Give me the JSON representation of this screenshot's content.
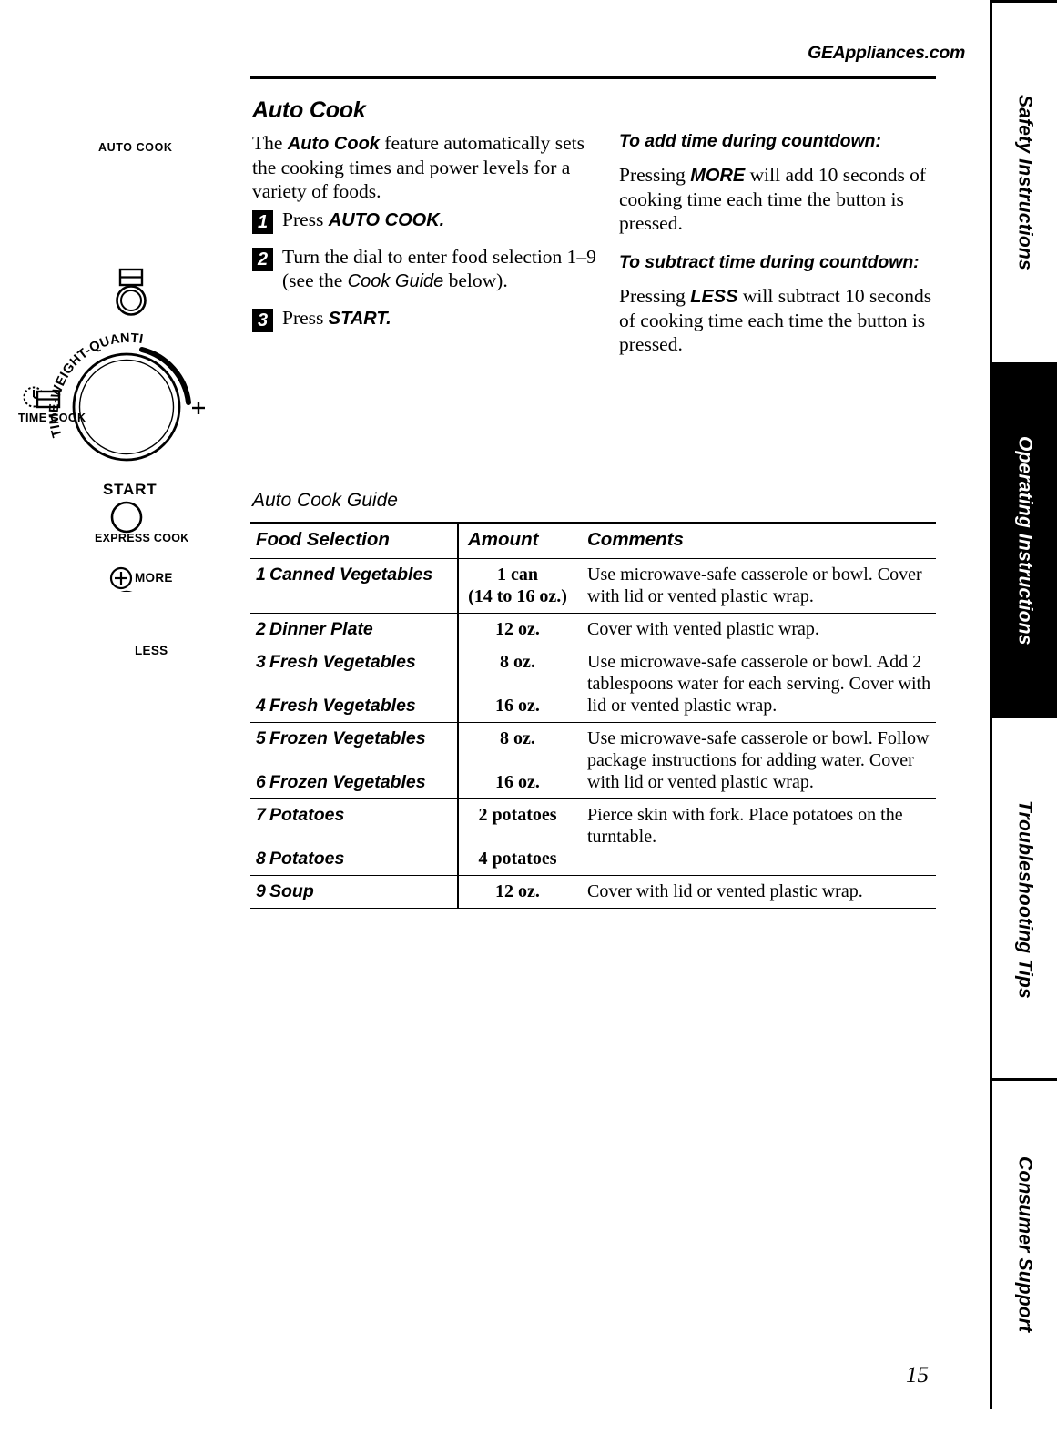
{
  "header": {
    "site_url": "GEAppliances.com"
  },
  "page_number": "15",
  "sidebar": {
    "tabs": [
      {
        "label": "Safety Instructions",
        "active": false
      },
      {
        "label": "Operating Instructions",
        "active": true
      },
      {
        "label": "Troubleshooting Tips",
        "active": false
      },
      {
        "label": "Consumer Support",
        "active": false
      }
    ]
  },
  "control_panel": {
    "auto_cook_label": "AUTO COOK",
    "dial_label": "TIME-WEIGHT-QUANTITY",
    "time_cook_label": "TIME COOK",
    "plus_label": "+",
    "start_label": "START",
    "express_cook_label": "EXPRESS COOK",
    "more_label": "MORE",
    "more_symbol": "+",
    "less_label": "LESS",
    "less_symbol": "−"
  },
  "main": {
    "section_title": "Auto Cook",
    "intro": {
      "lead": "The ",
      "emphasis": "Auto Cook",
      "rest": " feature automatically sets the cooking times and power levels for a variety of foods."
    },
    "steps": [
      {
        "num": "1",
        "pre": "Press ",
        "bold": "AUTO COOK.",
        "post": ""
      },
      {
        "num": "2",
        "pre": "Turn the dial to enter food selection 1–9 (see the ",
        "italic": "Cook Guide",
        "post": " below)."
      },
      {
        "num": "3",
        "pre": "Press ",
        "bold": "START.",
        "post": ""
      }
    ],
    "add_time": {
      "heading": "To add time during countdown:",
      "pre": "Pressing ",
      "bold": "MORE",
      "post": " will add 10 seconds of cooking time each time the button is pressed."
    },
    "subtract_time": {
      "heading": "To subtract time during countdown:",
      "pre": "Pressing ",
      "bold": "LESS",
      "post": "  will subtract 10 seconds of cooking time each time the button is pressed."
    }
  },
  "table": {
    "title": "Auto Cook Guide",
    "columns": [
      "Food Selection",
      "Amount",
      "Comments"
    ],
    "rows": [
      {
        "selections": [
          {
            "num": "1",
            "name": "Canned Vegetables"
          }
        ],
        "amounts": [
          "1 can",
          "(14 to 16 oz.)"
        ],
        "comment": "Use microwave-safe casserole or bowl. Cover with lid or vented plastic wrap."
      },
      {
        "selections": [
          {
            "num": "2",
            "name": "Dinner Plate"
          }
        ],
        "amounts": [
          "12 oz."
        ],
        "comment": "Cover with vented plastic wrap."
      },
      {
        "selections": [
          {
            "num": "3",
            "name": "Fresh Vegetables"
          },
          {
            "num": "4",
            "name": "Fresh Vegetables"
          }
        ],
        "amounts": [
          "8 oz.",
          "",
          "16 oz."
        ],
        "comment": "Use microwave-safe casserole or bowl. Add 2 tablespoons water for each serving. Cover with lid or vented plastic wrap."
      },
      {
        "selections": [
          {
            "num": "5",
            "name": "Frozen Vegetables"
          },
          {
            "num": "6",
            "name": "Frozen Vegetables"
          }
        ],
        "amounts": [
          "8 oz.",
          "",
          "16 oz."
        ],
        "comment": "Use microwave-safe casserole or bowl. Follow package instructions for adding water. Cover with lid or vented plastic wrap."
      },
      {
        "selections": [
          {
            "num": "7",
            "name": "Potatoes"
          },
          {
            "num": "8",
            "name": "Potatoes"
          }
        ],
        "amounts": [
          "2 potatoes",
          "",
          "4 potatoes"
        ],
        "comment": "Pierce skin with fork. Place potatoes on the turntable."
      },
      {
        "selections": [
          {
            "num": "9",
            "name": "Soup"
          }
        ],
        "amounts": [
          "12 oz."
        ],
        "comment": "Cover with lid or vented plastic wrap."
      }
    ]
  }
}
